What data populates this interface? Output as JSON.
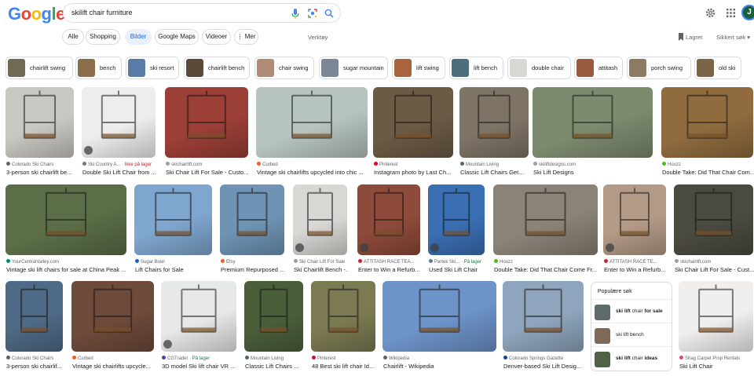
{
  "header": {
    "logo_letters": [
      {
        "ch": "G",
        "color": "#4285f4"
      },
      {
        "ch": "o",
        "color": "#ea4335"
      },
      {
        "ch": "o",
        "color": "#fbbc05"
      },
      {
        "ch": "g",
        "color": "#4285f4"
      },
      {
        "ch": "l",
        "color": "#34a853"
      },
      {
        "ch": "e",
        "color": "#ea4335"
      }
    ],
    "search_query": "skilift chair furniture",
    "icons": [
      "mic-icon",
      "lens-icon",
      "search-icon",
      "settings-gear-icon",
      "apps-grid-icon",
      "avatar"
    ],
    "avatar_letter": "J",
    "avatar_color": "#1a5e3a"
  },
  "tabs": [
    {
      "label": "Alle",
      "active": false
    },
    {
      "label": "Shopping",
      "active": false
    },
    {
      "label": "Bilder",
      "active": true
    },
    {
      "label": "Google Maps",
      "active": false
    },
    {
      "label": "Videoer",
      "active": false
    },
    {
      "label": "⋮ Mer",
      "active": false
    }
  ],
  "tools_label": "Verktøy",
  "saved_label": "Lagret",
  "safesearch_label": "Sikkert søk",
  "chips": [
    {
      "label": "chairlift swing",
      "thumb": "#6e6a55"
    },
    {
      "label": "bench",
      "thumb": "#8a6d4a"
    },
    {
      "label": "ski resort",
      "thumb": "#5a7aa8"
    },
    {
      "label": "chairlift bench",
      "thumb": "#5b4a3a"
    },
    {
      "label": "chair swing",
      "thumb": "#b08b76"
    },
    {
      "label": "sugar mountain",
      "thumb": "#7a8595"
    },
    {
      "label": "lift swing",
      "thumb": "#a7643d"
    },
    {
      "label": "lift bench",
      "thumb": "#4d6f7d"
    },
    {
      "label": "double chair",
      "thumb": "#d8d8d4"
    },
    {
      "label": "attitash",
      "thumb": "#9a5a3f"
    },
    {
      "label": "porch swing",
      "thumb": "#8c7b63"
    },
    {
      "label": "old ski",
      "thumb": "#7a6548"
    }
  ],
  "rows": [
    [
      {
        "source": "Colorado Ski Chairs",
        "title": "3-person ski chairlift be...",
        "color": "#c9c7c1",
        "fav": "#5f6368"
      },
      {
        "source": "Ski Country A...",
        "extra": "Ikke på lager",
        "extra_color": "red",
        "title": "Double Ski Lift Chair from ...",
        "color": "#ecedec",
        "fav": "#8d6e63",
        "badge": true
      },
      {
        "source": "skichairlift.com",
        "title": "Ski Chair Lift For Sale - Custo...",
        "color": "#9c3f37",
        "fav": "#9e9e9e"
      },
      {
        "source": "Curbed",
        "title": "Vintage ski chairlifts upcycled into chic ...",
        "color": "#b6c3bf",
        "fav": "#ff5722"
      },
      {
        "source": "Pinterest",
        "title": "Instagram photo by Last Ch...",
        "color": "#6b5a44",
        "fav": "#e60023"
      },
      {
        "source": "Mountain Living",
        "title": "Classic Lift Chairs Get...",
        "color": "#7e7466",
        "fav": "#4e6e5d"
      },
      {
        "source": "skiliftdesigns.com",
        "title": "Ski Lift Designs",
        "color": "#7c8a6e",
        "fav": "#9e9e9e"
      },
      {
        "source": "Houzz",
        "title": "Double Take: Did That Chair Com...",
        "color": "#8f6b3e",
        "fav": "#4dbc15"
      }
    ],
    [
      {
        "source": "YourCentralValley.com",
        "title": "Vintage ski lift chairs for sale at China Peak ...",
        "color": "#5b6e47",
        "fav": "#00897b"
      },
      {
        "source": "Sugar Bowl",
        "title": "Lift Chairs for Sale",
        "color": "#7fa6cf",
        "fav": "#1565c0"
      },
      {
        "source": "Etsy",
        "title": "Premium Repurposed ...",
        "color": "#6f93b4",
        "fav": "#f1641e"
      },
      {
        "source": "Ski Chair Lift For Sale",
        "title": "Ski Chairlift Bench -...",
        "color": "#d9d7d3",
        "fav": "#9e9e9e",
        "badge": true
      },
      {
        "source": "ATTITASH RACE TEA...",
        "title": "Enter to Win a Refurb...",
        "color": "#8e4a3a",
        "fav": "#c62828",
        "badge": true
      },
      {
        "source": "Partek Ski...",
        "extra": "På lager",
        "extra_color": "green",
        "title": "Used Ski Lift Chair",
        "color": "#3a6fb4",
        "fav": "#607d8b",
        "badge": true
      },
      {
        "source": "Houzz",
        "title": "Double Take: Did That Chair Come Fr...",
        "color": "#8a8378",
        "fav": "#4dbc15"
      },
      {
        "source": "ATTITASH RACE TE...",
        "title": "Enter to Win a Refurb...",
        "color": "#b39a86",
        "fav": "#c62828",
        "badge": true
      },
      {
        "source": "skichairlift.com",
        "title": "Ski Chair Lift For Sale - Cust...",
        "color": "#4b4a40",
        "fav": "#9e9e9e"
      }
    ],
    [
      {
        "source": "Colorado Ski Chairs",
        "title": "3-person ski chairlif...",
        "color": "#4f6a86",
        "fav": "#5f6368"
      },
      {
        "source": "Curbed",
        "title": "Vintage ski chairlifts upcycle...",
        "color": "#6e4a3a",
        "fav": "#ff5722"
      },
      {
        "source": "CGTrader",
        "extra": "På lager",
        "extra_color": "green",
        "title": "3D model Ski lift chair VR ...",
        "color": "#e7e8e8",
        "fav": "#3949ab",
        "badge": true
      },
      {
        "source": "Mountain Living",
        "title": "Classic Lift Chairs ...",
        "color": "#4b5e3a",
        "fav": "#4e6e5d"
      },
      {
        "source": "Pinterest",
        "title": "48 Best ski lift chair Id...",
        "color": "#7b7a52",
        "fav": "#e60023"
      },
      {
        "source": "Wikipedia",
        "title": "Chairlift - Wikipedia",
        "color": "#6d93c9",
        "fav": "#616161"
      },
      {
        "source": "Colorado Springs Gazette",
        "title": "Denver-based Ski Lift Desig...",
        "color": "#8ea5bd",
        "fav": "#0d47a1"
      },
      {
        "source": "Shag Carpet Prop Rentals",
        "title": "Ski Lift Chair",
        "color": "#f1eeee",
        "fav": "#ec407a"
      }
    ]
  ],
  "popular": {
    "heading": "Populære søk",
    "items": [
      {
        "prefix": "ski lift ",
        "middle": "chair",
        "suffix": " for sale",
        "thumb": "#5f6a6b"
      },
      {
        "prefix": "",
        "middle": "ski lift bench",
        "suffix": "",
        "thumb": "#7e6a56"
      },
      {
        "prefix": "ski lift ",
        "middle": "chair",
        "suffix": " ideas",
        "thumb": "#506148"
      }
    ]
  }
}
